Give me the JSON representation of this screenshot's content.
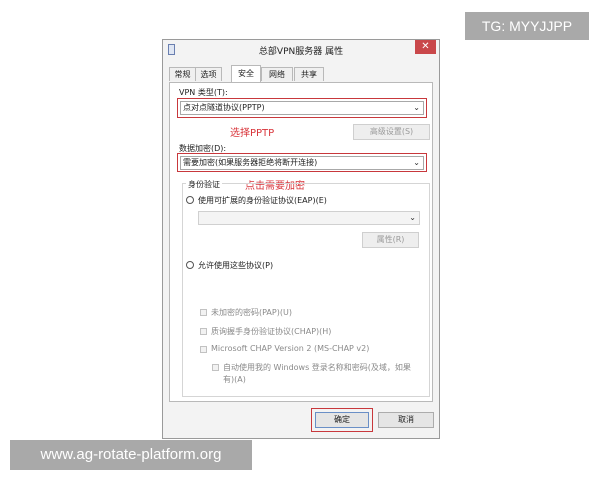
{
  "watermarks": {
    "top": "TG: MYYJJPP",
    "bottom": "www.ag-rotate-platform.org"
  },
  "window": {
    "title": "总部VPN服务器 属性",
    "close": "✕",
    "tabs": [
      "常规",
      "选项",
      "安全",
      "网络",
      "共享"
    ],
    "active_tab": "安全"
  },
  "vpn": {
    "type_label": "VPN 类型(T):",
    "type_value": "点对点隧道协议(PPTP)",
    "annotation": "选择PPTP",
    "advanced_button": "高级设置(S)"
  },
  "encryption": {
    "label": "数据加密(D):",
    "value": "需要加密(如果服务器拒绝将断开连接)",
    "annotation": "点击需要加密"
  },
  "auth": {
    "group_title": "身份验证",
    "eap_radio": "使用可扩展的身份验证协议(EAP)(E)",
    "eap_select": "",
    "properties_button": "属性(R)",
    "protocols_radio": "允许使用这些协议(P)",
    "pap": "未加密的密码(PAP)(U)",
    "chap": "质询握手身份验证协议(CHAP)(H)",
    "mschap": "Microsoft CHAP Version 2 (MS-CHAP v2)",
    "windows_login_line1": "自动使用我的 Windows 登录名称和密码(及域，如果",
    "windows_login_line2": "有)(A)"
  },
  "footer": {
    "ok": "确定",
    "cancel": "取消"
  },
  "colors": {
    "annotation_red": "#d8343a",
    "close_red": "#c9474a"
  }
}
